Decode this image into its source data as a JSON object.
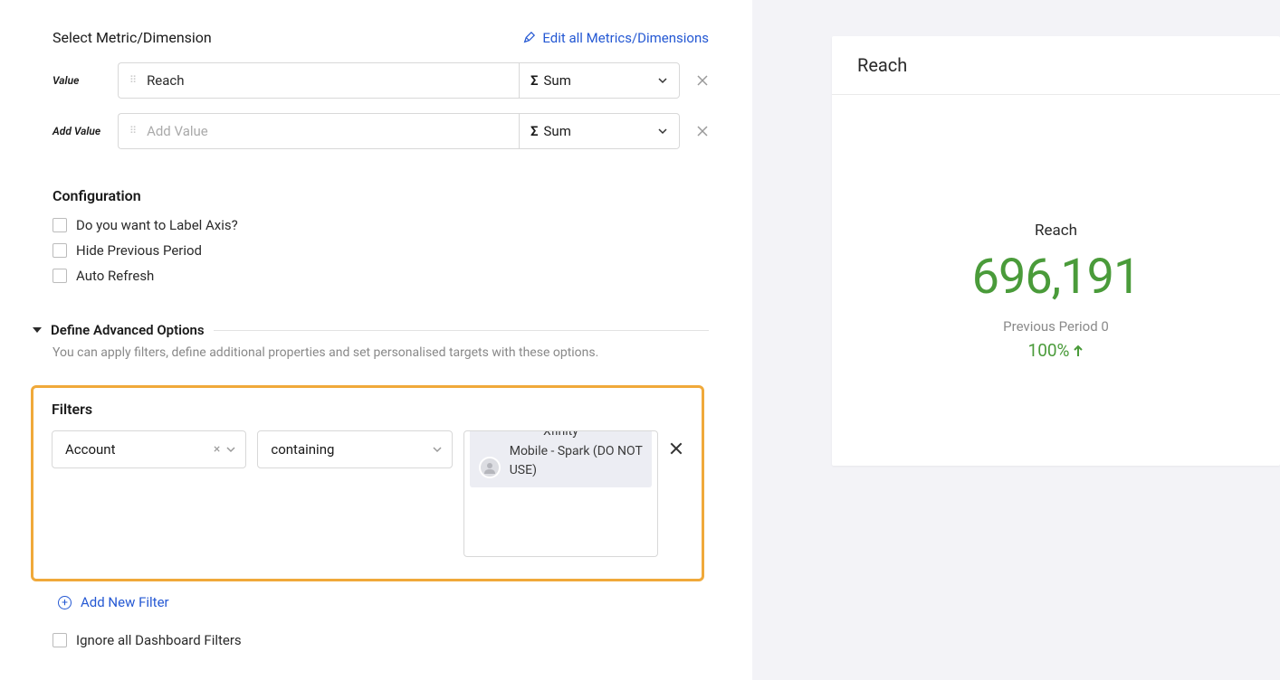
{
  "header": {
    "section_title": "Select Metric/Dimension",
    "edit_link": "Edit all Metrics/Dimensions"
  },
  "rows": {
    "value_label": "Value",
    "value_text": "Reach",
    "value_agg": "Sum",
    "addvalue_label": "Add Value",
    "addvalue_placeholder": "Add Value",
    "addvalue_agg": "Sum"
  },
  "configuration": {
    "heading": "Configuration",
    "opt_label_axis": "Do you want to Label Axis?",
    "opt_hide_prev": "Hide Previous Period",
    "opt_auto_refresh": "Auto Refresh"
  },
  "advanced": {
    "heading": "Define Advanced Options",
    "desc": "You can apply filters, define additional properties and set personalised targets with these options."
  },
  "filters": {
    "heading": "Filters",
    "field": "Account",
    "condition": "containing",
    "token_truncated": "Xfinity",
    "token_text": "Mobile - Spark (DO NOT USE)",
    "add_new": "Add New Filter",
    "ignore_label": "Ignore all Dashboard Filters"
  },
  "preview": {
    "title": "Reach",
    "metric_name": "Reach",
    "metric_value": "696,191",
    "previous_label": "Previous Period 0",
    "percent": "100%"
  }
}
